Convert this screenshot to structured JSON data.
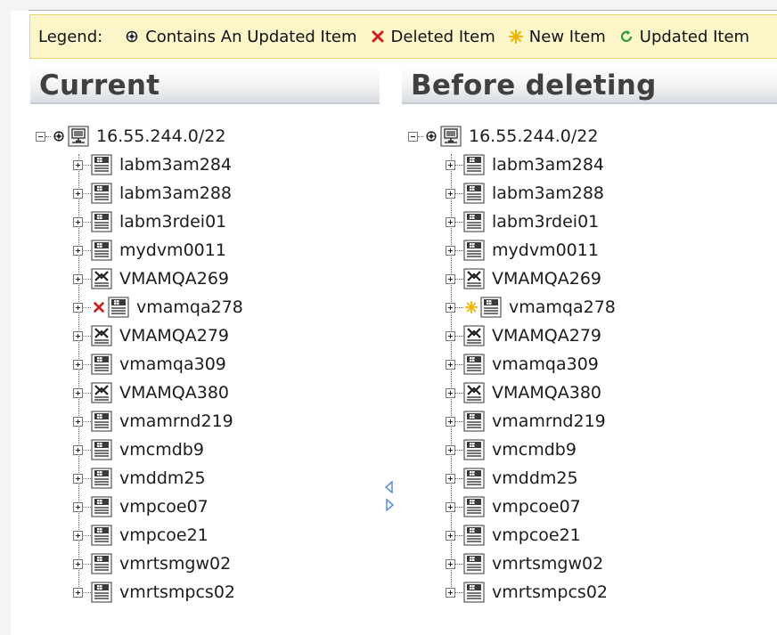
{
  "legend": {
    "title": "Legend:",
    "entries": [
      {
        "label": "Contains An Updated Item",
        "icon": "contains-updated-icon"
      },
      {
        "label": "Deleted Item",
        "icon": "deleted-x-icon",
        "color": "#cc1f1f"
      },
      {
        "label": "New Item",
        "icon": "new-star-icon",
        "color": "#f0b400"
      },
      {
        "label": "Updated Item",
        "icon": "updated-refresh-icon",
        "color": "#2e9e3a"
      }
    ]
  },
  "panels": {
    "current": {
      "title": "Current",
      "root": {
        "label": "16.55.244.0/22",
        "icon": "network-icon"
      },
      "children": [
        {
          "label": "labm3am284",
          "icon": "windows-server-icon"
        },
        {
          "label": "labm3am288",
          "icon": "windows-server-icon"
        },
        {
          "label": "labm3rdei01",
          "icon": "windows-server-icon"
        },
        {
          "label": "mydvm0011",
          "icon": "windows-server-icon"
        },
        {
          "label": "VMAMQA269",
          "icon": "unix-server-icon"
        },
        {
          "label": "vmamqa278",
          "icon": "windows-server-icon",
          "status": "deleted"
        },
        {
          "label": "VMAMQA279",
          "icon": "unix-server-icon"
        },
        {
          "label": "vmamqa309",
          "icon": "windows-server-icon"
        },
        {
          "label": "VMAMQA380",
          "icon": "unix-server-icon"
        },
        {
          "label": "vmamrnd219",
          "icon": "windows-server-icon"
        },
        {
          "label": "vmcmdb9",
          "icon": "windows-server-icon"
        },
        {
          "label": "vmddm25",
          "icon": "windows-server-icon"
        },
        {
          "label": "vmpcoe07",
          "icon": "windows-server-icon"
        },
        {
          "label": "vmpcoe21",
          "icon": "windows-server-icon"
        },
        {
          "label": "vmrtsmgw02",
          "icon": "windows-server-icon"
        },
        {
          "label": "vmrtsmpcs02",
          "icon": "windows-server-icon"
        }
      ]
    },
    "before": {
      "title": "Before deleting",
      "root": {
        "label": "16.55.244.0/22",
        "icon": "network-icon"
      },
      "children": [
        {
          "label": "labm3am284",
          "icon": "windows-server-icon"
        },
        {
          "label": "labm3am288",
          "icon": "windows-server-icon"
        },
        {
          "label": "labm3rdei01",
          "icon": "windows-server-icon"
        },
        {
          "label": "mydvm0011",
          "icon": "windows-server-icon"
        },
        {
          "label": "VMAMQA269",
          "icon": "unix-server-icon"
        },
        {
          "label": "vmamqa278",
          "icon": "windows-server-icon",
          "status": "new"
        },
        {
          "label": "VMAMQA279",
          "icon": "unix-server-icon"
        },
        {
          "label": "vmamqa309",
          "icon": "windows-server-icon"
        },
        {
          "label": "VMAMQA380",
          "icon": "unix-server-icon"
        },
        {
          "label": "vmamrnd219",
          "icon": "windows-server-icon"
        },
        {
          "label": "vmcmdb9",
          "icon": "windows-server-icon"
        },
        {
          "label": "vmddm25",
          "icon": "windows-server-icon"
        },
        {
          "label": "vmpcoe07",
          "icon": "windows-server-icon"
        },
        {
          "label": "vmpcoe21",
          "icon": "windows-server-icon"
        },
        {
          "label": "vmrtsmgw02",
          "icon": "windows-server-icon"
        },
        {
          "label": "vmrtsmpcs02",
          "icon": "windows-server-icon"
        }
      ]
    }
  },
  "splitter": {
    "left_icon": "triangle-left-icon",
    "right_icon": "triangle-right-icon",
    "color": "#5b8fd6"
  }
}
